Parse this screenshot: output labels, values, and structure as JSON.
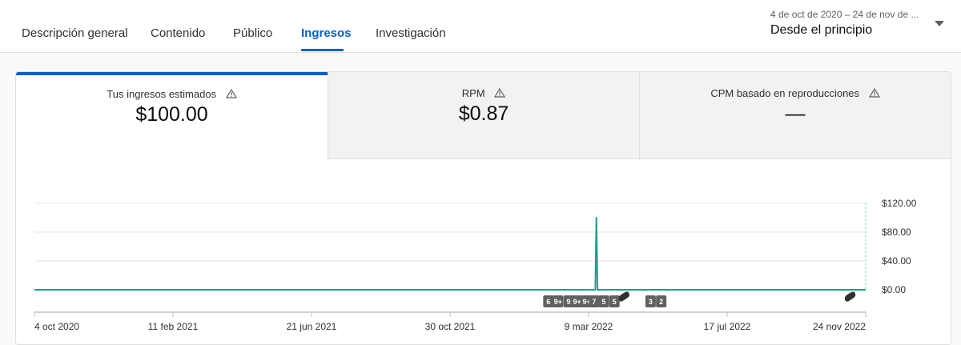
{
  "tabs": [
    {
      "label": "Descripción general",
      "active": false
    },
    {
      "label": "Contenido",
      "active": false
    },
    {
      "label": "Público",
      "active": false
    },
    {
      "label": "Ingresos",
      "active": true
    },
    {
      "label": "Investigación",
      "active": false
    }
  ],
  "date_selector": {
    "range": "4 de oct de 2020 – 24 de nov de ...",
    "preset": "Desde el principio"
  },
  "metrics": [
    {
      "label": "Tus ingresos estimados",
      "value": "$100.00"
    },
    {
      "label": "RPM",
      "value": "$0.87"
    },
    {
      "label": "CPM basado en reproducciones",
      "value": "—"
    }
  ],
  "colors": {
    "accent": "#065fd4",
    "series": "#1aa08a"
  },
  "chart_data": {
    "type": "line",
    "x_start": "2020-10-04",
    "x_end": "2022-11-24",
    "x_tick_labels": [
      "4 oct 2020",
      "11 feb 2021",
      "21 jun 2021",
      "30 oct 2021",
      "9 mar 2022",
      "17 jul 2022",
      "24 nov 2022"
    ],
    "y_tick_labels": [
      "$120.00",
      "$80.00",
      "$40.00",
      "$0.00"
    ],
    "ylim": [
      0,
      120
    ],
    "series": [
      {
        "points": [
          [
            "2020-10-04",
            0
          ],
          [
            "2022-03-15",
            0
          ],
          [
            "2022-03-16",
            100
          ],
          [
            "2022-03-17",
            0
          ],
          [
            "2022-11-24",
            0
          ]
        ]
      }
    ],
    "annotation_badges": [
      {
        "date": "2022-01-25",
        "label": "6"
      },
      {
        "date": "2022-02-03",
        "label": "9+"
      },
      {
        "date": "2022-02-13",
        "label": "9"
      },
      {
        "date": "2022-02-21",
        "label": "9+"
      },
      {
        "date": "2022-03-02",
        "label": "9+"
      },
      {
        "date": "2022-03-09",
        "label": "7"
      },
      {
        "date": "2022-03-18",
        "label": "5"
      },
      {
        "date": "2022-03-28",
        "label": "5"
      },
      {
        "date": "2022-04-06",
        "label": "shorts"
      },
      {
        "date": "2022-05-01",
        "label": "3"
      },
      {
        "date": "2022-05-11",
        "label": "2"
      },
      {
        "date": "2022-11-24",
        "label": "shorts"
      }
    ]
  }
}
